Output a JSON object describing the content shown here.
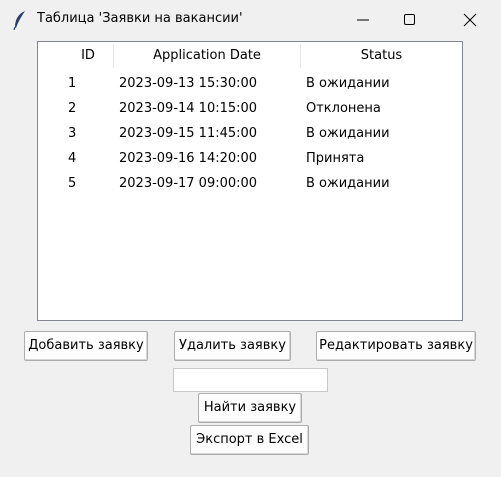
{
  "window": {
    "title": "Таблица 'Заявки на вакансии'",
    "icons": [
      "feather-app-icon",
      "minimize-icon",
      "maximize-icon",
      "close-icon"
    ]
  },
  "table": {
    "columns": [
      "ID",
      "Application Date",
      "Status"
    ],
    "rows": [
      {
        "id": "1",
        "date": "2023-09-13 15:30:00",
        "status": "В ожидании"
      },
      {
        "id": "2",
        "date": "2023-09-14 10:15:00",
        "status": "Отклонена"
      },
      {
        "id": "3",
        "date": "2023-09-15 11:45:00",
        "status": "В ожидании"
      },
      {
        "id": "4",
        "date": "2023-09-16 14:20:00",
        "status": "Принята"
      },
      {
        "id": "5",
        "date": "2023-09-17 09:00:00",
        "status": "В ожидании"
      }
    ]
  },
  "buttons": {
    "add": "Добавить заявку",
    "delete": "Удалить заявку",
    "edit": "Редактировать заявку",
    "find": "Найти заявку",
    "export": "Экспорт в Excel"
  },
  "search": {
    "value": ""
  }
}
